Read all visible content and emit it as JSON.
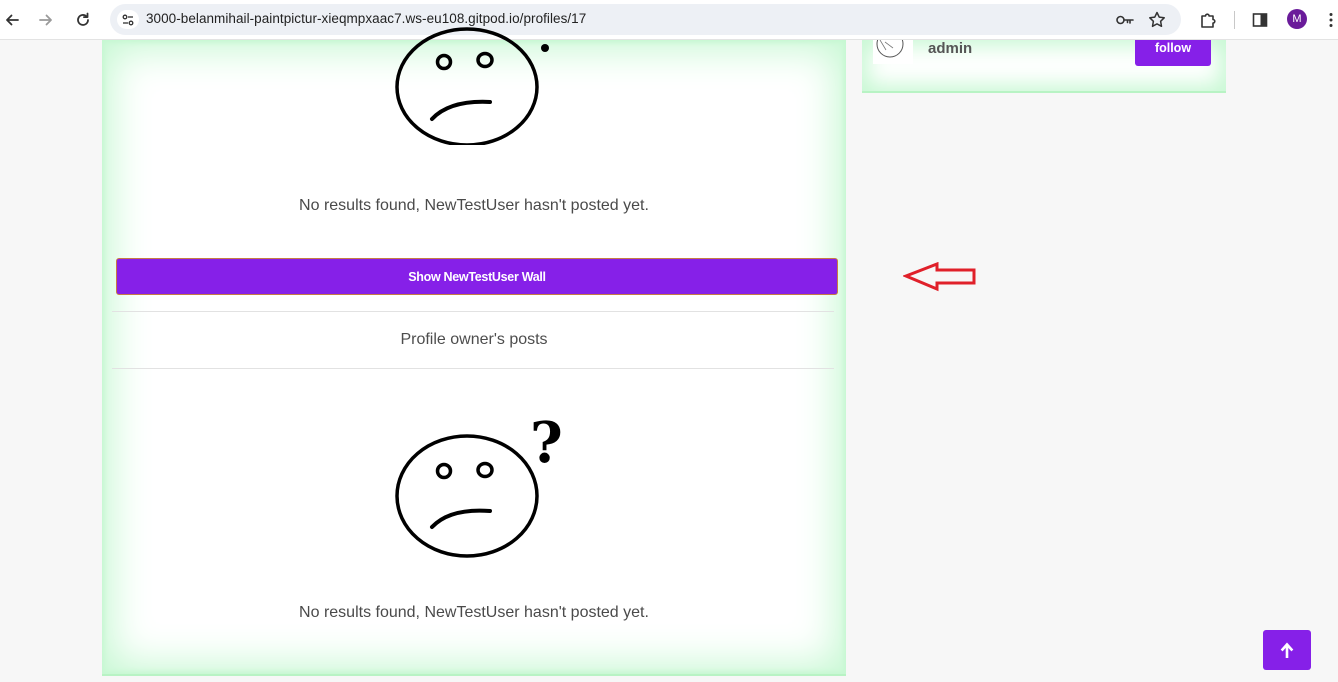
{
  "browser": {
    "url": "3000-belanmihail-paintpictur-xieqmpxaac7.ws-eu108.gitpod.io/profiles/17",
    "profile_initial": "M"
  },
  "main": {
    "empty_message_top": "No results found, NewTestUser hasn't posted yet.",
    "wall_button_label": "Show NewTestUser Wall",
    "section_title": "Profile owner's posts",
    "empty_message_bottom": "No results found, NewTestUser hasn't posted yet.",
    "question_mark": "?"
  },
  "sidebar": {
    "username": "admin",
    "follow_label": "follow"
  },
  "icons": {
    "back": "arrow-left-icon",
    "forward": "arrow-right-icon",
    "reload": "reload-icon",
    "site_info": "tune-icon",
    "password": "key-icon",
    "bookmark": "star-icon",
    "extensions": "puzzle-icon",
    "side_panel": "sidebar-icon",
    "menu": "kebab-menu-icon",
    "scroll_top": "arrow-up-icon",
    "annotation": "red-arrow-icon"
  },
  "colors": {
    "accent": "#8620e8",
    "card_glow": "#c7f8d3",
    "annotation": "#e0202a"
  }
}
